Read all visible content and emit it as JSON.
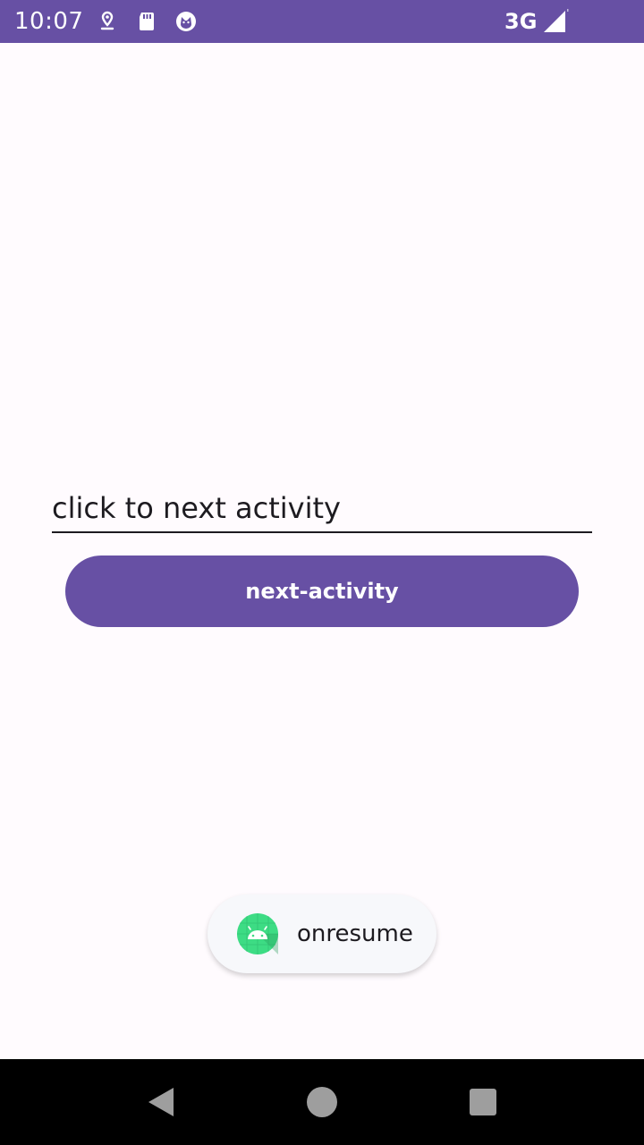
{
  "status_bar": {
    "time": "10:07",
    "network": "3G",
    "background_color": "#6750a4",
    "icons": [
      "location-icon",
      "sd-card-icon",
      "cat-app-icon",
      "signal-icon"
    ]
  },
  "main": {
    "edit_text_value": "click to next activity",
    "button_label": "next-activity",
    "accent_color": "#6750a4"
  },
  "toast": {
    "icon": "android-icon",
    "text": "onresume"
  },
  "nav_bar": {
    "icons": [
      "back-icon",
      "home-icon",
      "recents-icon"
    ]
  }
}
